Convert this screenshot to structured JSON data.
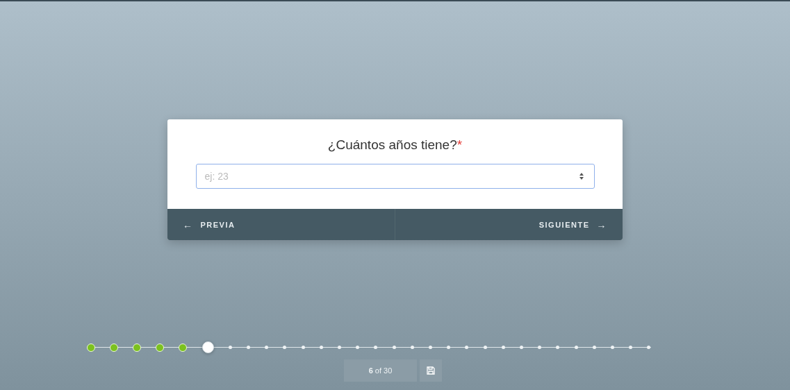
{
  "question": {
    "title": "¿Cuántos años tiene?",
    "required_mark": "*",
    "input": {
      "placeholder": "ej: 23"
    }
  },
  "nav": {
    "previous": {
      "arrow": "←",
      "label": "PREVIA"
    },
    "next": {
      "label": "SIGUIENTE",
      "arrow": "→"
    }
  },
  "progress": {
    "steps": [
      {
        "completed": true,
        "selected": false
      },
      {
        "completed": true,
        "selected": false
      },
      {
        "completed": true,
        "selected": false
      },
      {
        "completed": true,
        "selected": false
      },
      {
        "completed": true,
        "selected": false
      },
      {
        "completed": false,
        "selected": true
      },
      {
        "completed": false,
        "selected": false
      },
      {
        "completed": false,
        "selected": false
      },
      {
        "completed": false,
        "selected": false
      },
      {
        "completed": false,
        "selected": false
      },
      {
        "completed": false,
        "selected": false
      },
      {
        "completed": false,
        "selected": false
      },
      {
        "completed": false,
        "selected": false
      },
      {
        "completed": false,
        "selected": false
      },
      {
        "completed": false,
        "selected": false
      },
      {
        "completed": false,
        "selected": false
      },
      {
        "completed": false,
        "selected": false
      },
      {
        "completed": false,
        "selected": false
      },
      {
        "completed": false,
        "selected": false
      },
      {
        "completed": false,
        "selected": false
      },
      {
        "completed": false,
        "selected": false
      },
      {
        "completed": false,
        "selected": false
      },
      {
        "completed": false,
        "selected": false
      },
      {
        "completed": false,
        "selected": false
      },
      {
        "completed": false,
        "selected": false
      },
      {
        "completed": false,
        "selected": false
      },
      {
        "completed": false,
        "selected": false
      },
      {
        "completed": false,
        "selected": false
      },
      {
        "completed": false,
        "selected": false
      },
      {
        "completed": false,
        "selected": false
      }
    ],
    "counter": "**6** of 30"
  }
}
